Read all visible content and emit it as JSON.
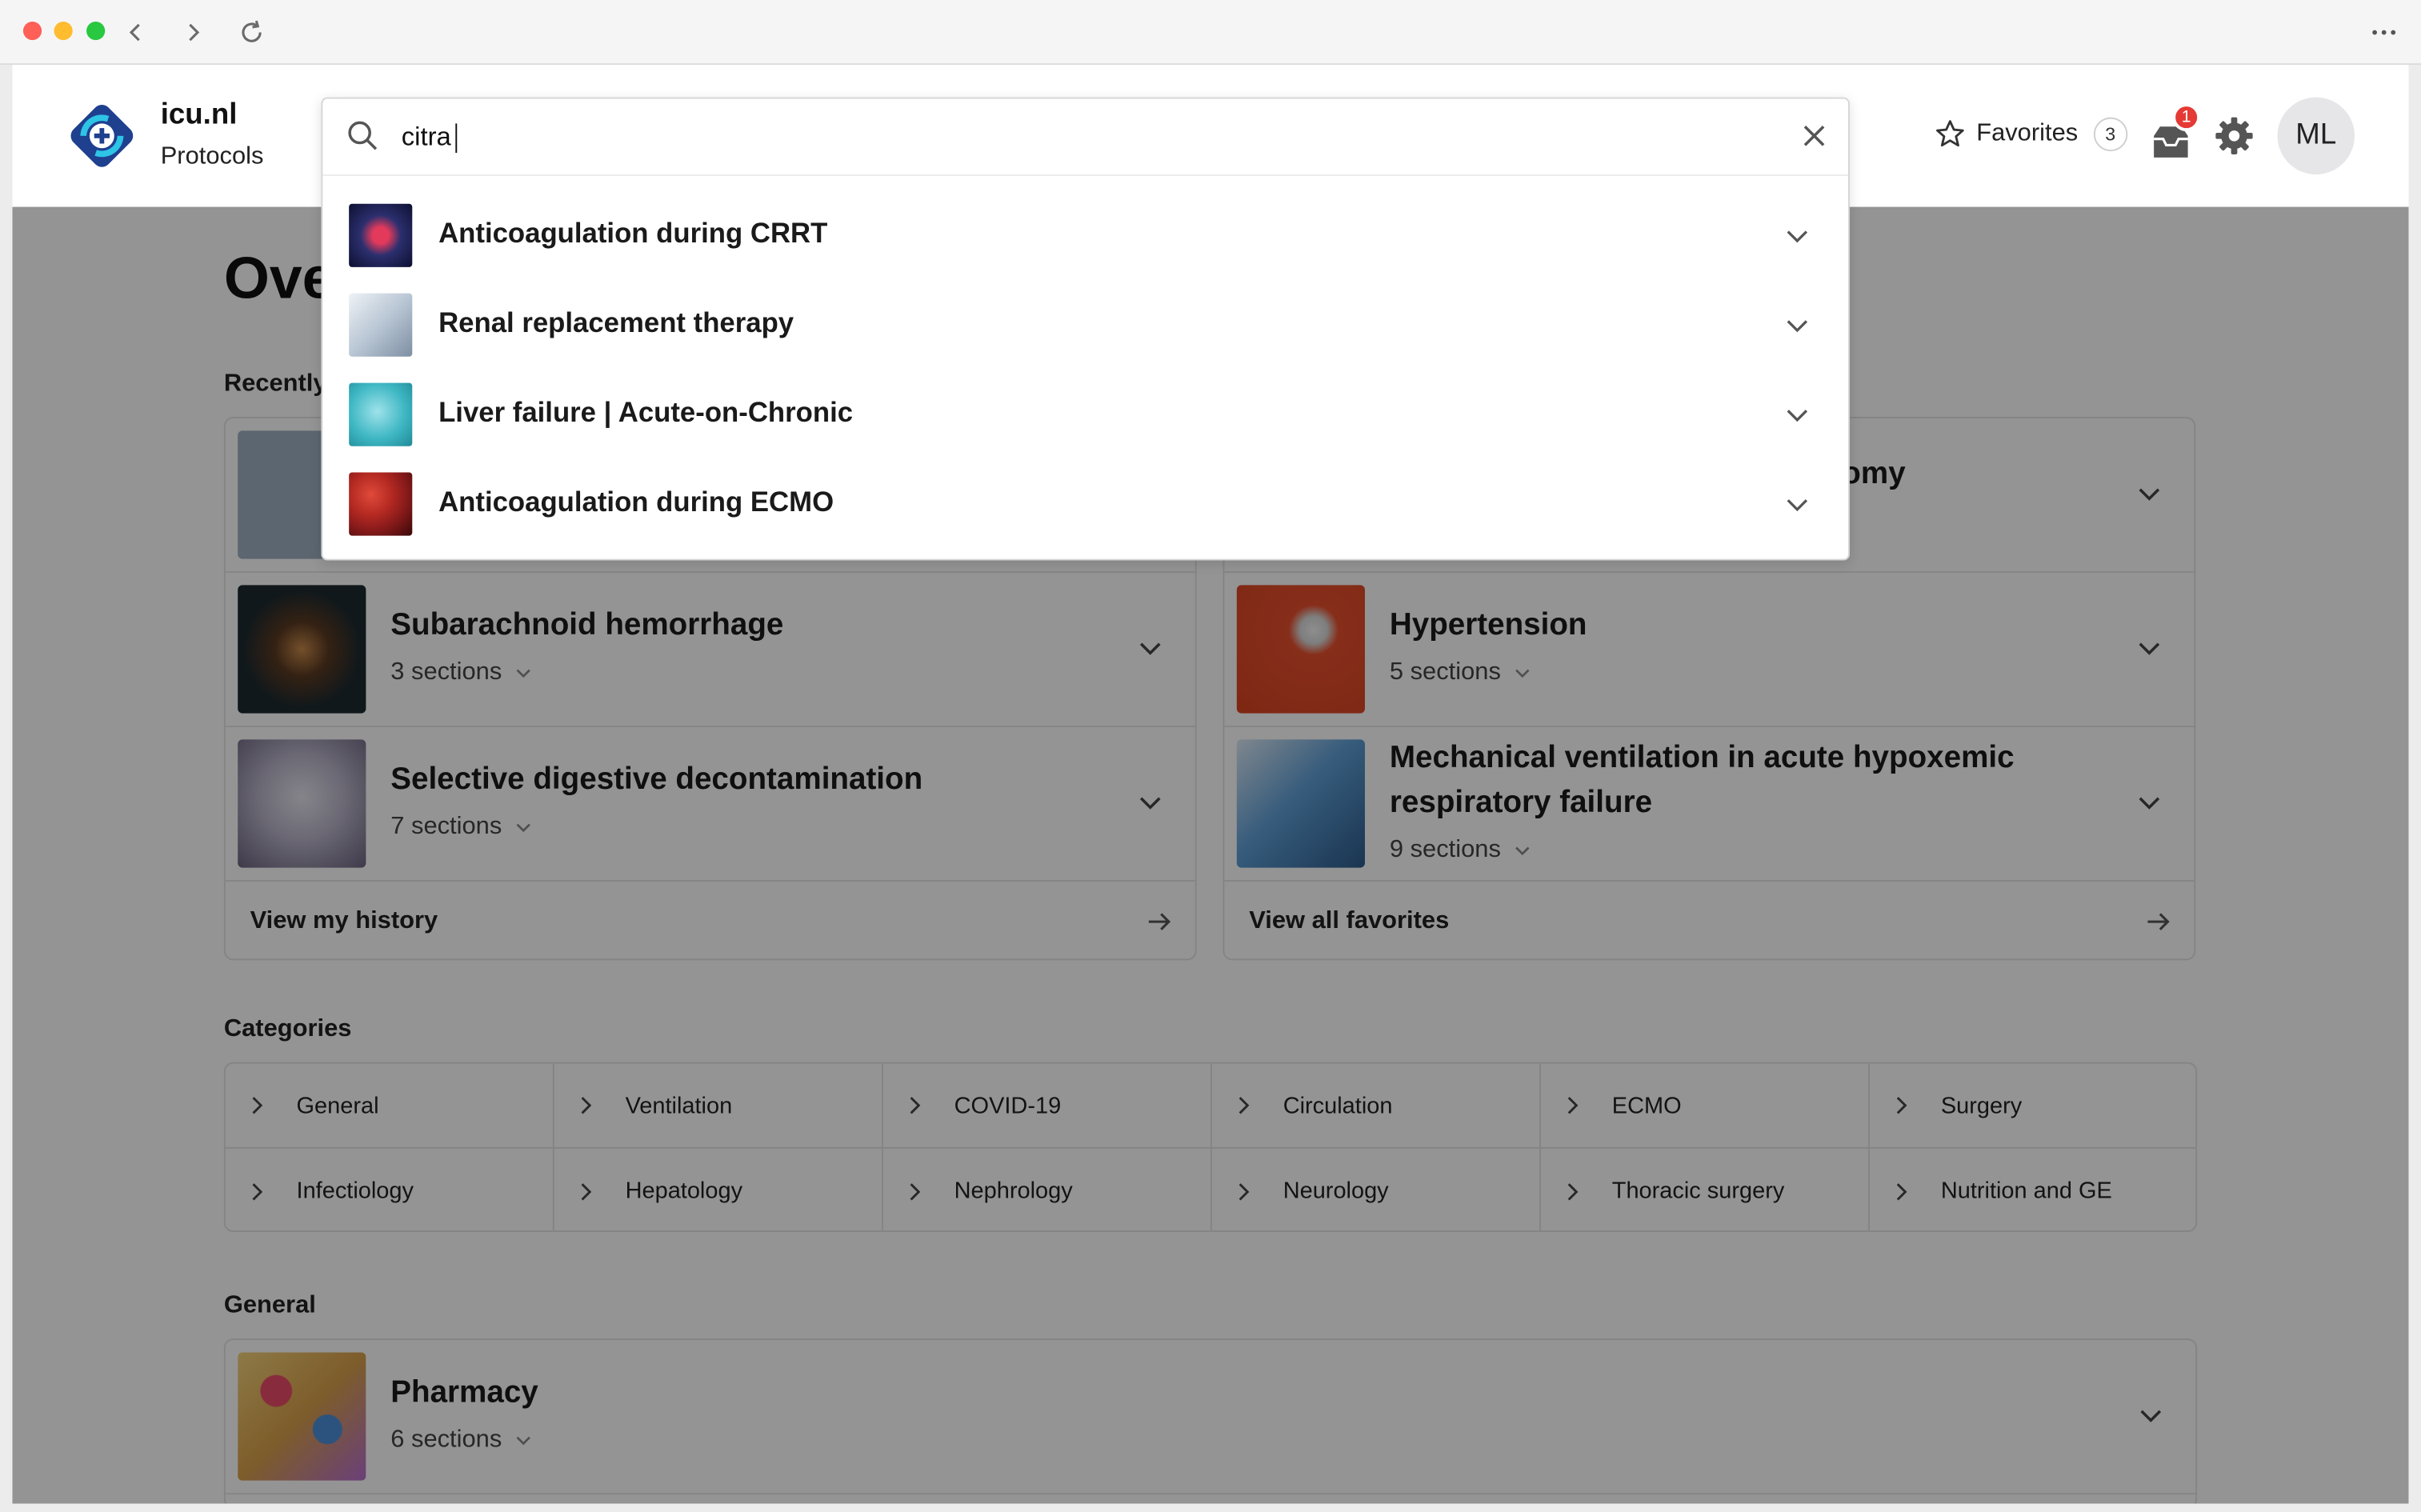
{
  "browser": {
    "controls": [
      "back",
      "forward",
      "reload",
      "more"
    ]
  },
  "brand": {
    "name": "icu.nl",
    "subtitle": "Protocols"
  },
  "header": {
    "favorites_label": "Favorites",
    "favorites_count": "3",
    "inbox_badge": "1",
    "avatar_initials": "ML"
  },
  "search": {
    "value": "citra",
    "results": [
      {
        "title": "Anticoagulation during CRRT",
        "thumb_color": "#2b2f6e"
      },
      {
        "title": "Renal replacement therapy",
        "thumb_color": "#b9c6d4"
      },
      {
        "title": "Liver failure | Acute-on-Chronic",
        "thumb_color": "#3fb8c4"
      },
      {
        "title": "Anticoagulation during ECMO",
        "thumb_color": "#8a1b1b"
      }
    ]
  },
  "overview": {
    "title": "Ove",
    "recently_label": "Recently",
    "recent": [
      {
        "title": "Subarachnoid hemorrhage",
        "sections": "3 sections",
        "thumb_color": "#1d2a30"
      },
      {
        "title": "Selective digestive decontamination",
        "sections": "7 sections",
        "thumb_color": "#b8b4c8"
      }
    ],
    "recent_footer": "View my history",
    "favorites": [
      {
        "title": "omy"
      },
      {
        "title": "Hypertension",
        "sections": "5 sections",
        "thumb_color": "#e8502e"
      },
      {
        "title_line1": "Mechanical ventilation in acute hypoxemic",
        "title_line2": "respiratory failure",
        "sections": "9 sections",
        "thumb_color": "#5f9fd6"
      }
    ],
    "favorites_footer": "View all favorites"
  },
  "categories": {
    "label": "Categories",
    "items": [
      "General",
      "Ventilation",
      "COVID-19",
      "Circulation",
      "ECMO",
      "Surgery",
      "Infectiology",
      "Hepatology",
      "Nephrology",
      "Neurology",
      "Thoracic surgery",
      "Nutrition and GE"
    ]
  },
  "general": {
    "label": "General",
    "items": [
      {
        "title": "Pharmacy",
        "sections": "6 sections",
        "thumb_color": "#d8a04a"
      }
    ]
  },
  "colors": {
    "brand_blue": "#1f3f8f",
    "brand_cyan": "#2ec4e6",
    "badge_red": "#e53935",
    "overlay": "rgba(0,0,0,0.42)"
  }
}
